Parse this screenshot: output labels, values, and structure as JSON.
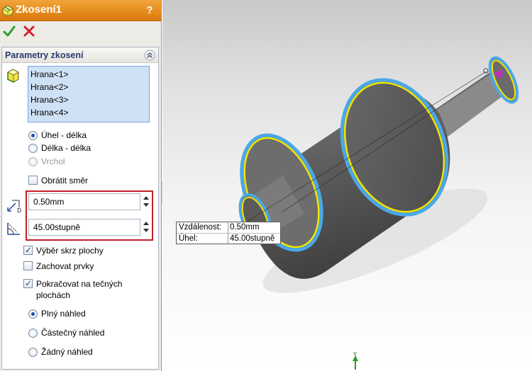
{
  "window": {
    "title": "Zkosení1",
    "help_label": "?"
  },
  "group": {
    "title": "Parametry zkosení"
  },
  "edges": [
    "Hrana<1>",
    "Hrana<2>",
    "Hrana<3>",
    "Hrana<4>"
  ],
  "chamfer_type": {
    "options": [
      {
        "label": "Úhel - délka",
        "selected": true,
        "enabled": true
      },
      {
        "label": "Délka - délka",
        "selected": false,
        "enabled": true
      },
      {
        "label": "Vrchol",
        "selected": false,
        "enabled": false
      }
    ]
  },
  "flip_direction": {
    "label": "Obrátit směr",
    "checked": false
  },
  "distance": {
    "value": "0.50mm"
  },
  "angle": {
    "value": "45.00stupně"
  },
  "options": [
    {
      "label": "Výběr skrz plochy",
      "checked": true
    },
    {
      "label": "Zachovat prvky",
      "checked": false
    },
    {
      "label_line1": "Pokračovat na tečných",
      "label_line2": "plochách",
      "checked": true
    }
  ],
  "preview": {
    "options": [
      {
        "label": "Plný náhled",
        "selected": true
      },
      {
        "label": "Částečný náhled",
        "selected": false
      },
      {
        "label": "Žádný náhled",
        "selected": false
      }
    ]
  },
  "callout": {
    "distance_label": "Vzdálenost:",
    "distance_value": "0.50mm",
    "angle_label": "Úhel:",
    "angle_value": "45.00stupně"
  },
  "triad": {
    "axis_label": "Y"
  },
  "colors": {
    "title_bar": "#e48a1a",
    "selection_list": "#cfe1f5",
    "edge_highlight": "#f2e600",
    "face_highlight": "#4aa8e8",
    "highlight_box": "#c0202a",
    "model_body": "#5d5d5d"
  }
}
